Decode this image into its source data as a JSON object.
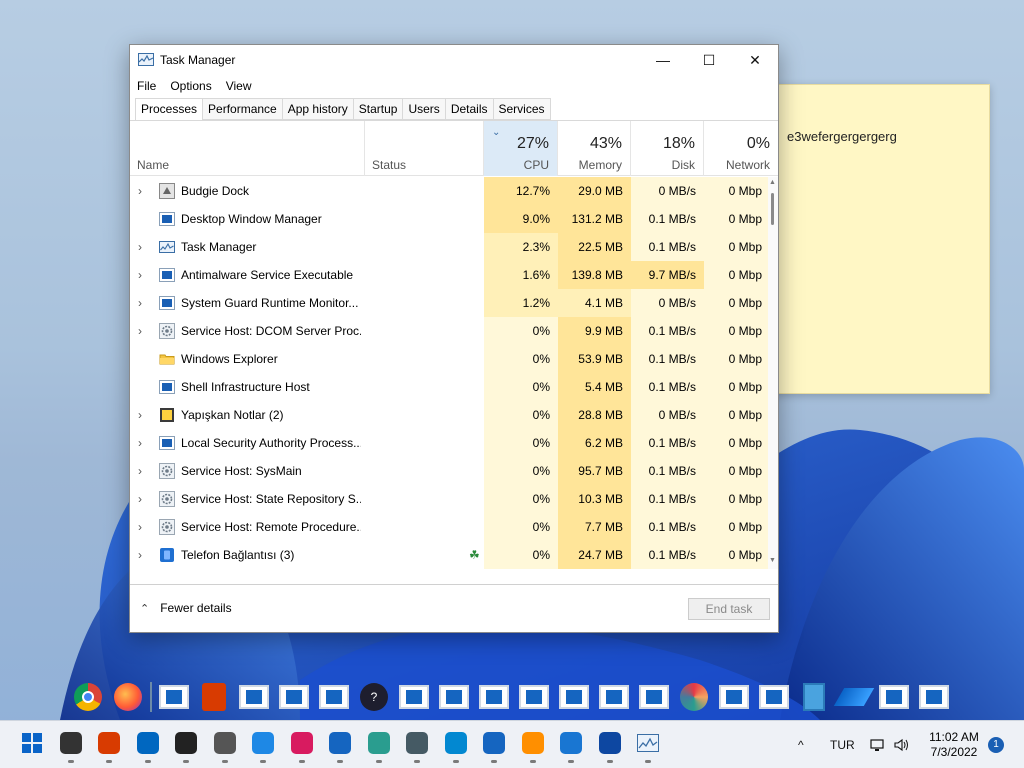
{
  "sticky_note": {
    "text": "e3wefergergergerg"
  },
  "window": {
    "title": "Task Manager",
    "controls": {
      "minimize": "—",
      "maximize": "☐",
      "close": "✕"
    }
  },
  "menu": [
    "File",
    "Options",
    "View"
  ],
  "tabs": [
    "Processes",
    "Performance",
    "App history",
    "Startup",
    "Users",
    "Details",
    "Services"
  ],
  "active_tab": "Processes",
  "columns": {
    "name": "Name",
    "status": "Status",
    "cpu": {
      "label": "CPU",
      "percent": "27%"
    },
    "memory": {
      "label": "Memory",
      "percent": "43%"
    },
    "disk": {
      "label": "Disk",
      "percent": "18%"
    },
    "network": {
      "label": "Network",
      "percent": "0%"
    }
  },
  "processes": [
    {
      "expand": "›",
      "icon": "budgie-dock-icon",
      "name": "Budgie Dock",
      "status": "",
      "cpu": "12.7%",
      "memory": "29.0 MB",
      "disk": "0 MB/s",
      "network": "0 Mbp"
    },
    {
      "expand": "",
      "icon": "window-icon",
      "name": "Desktop Window Manager",
      "status": "",
      "cpu": "9.0%",
      "memory": "131.2 MB",
      "disk": "0.1 MB/s",
      "network": "0 Mbp"
    },
    {
      "expand": "›",
      "icon": "task-manager-icon",
      "name": "Task Manager",
      "status": "",
      "cpu": "2.3%",
      "memory": "22.5 MB",
      "disk": "0.1 MB/s",
      "network": "0 Mbp"
    },
    {
      "expand": "›",
      "icon": "window-icon",
      "name": "Antimalware Service Executable",
      "status": "",
      "cpu": "1.6%",
      "memory": "139.8 MB",
      "disk": "9.7 MB/s",
      "network": "0 Mbp"
    },
    {
      "expand": "›",
      "icon": "window-icon",
      "name": "System Guard Runtime Monitor...",
      "status": "",
      "cpu": "1.2%",
      "memory": "4.1 MB",
      "disk": "0 MB/s",
      "network": "0 Mbp"
    },
    {
      "expand": "›",
      "icon": "gear-icon",
      "name": "Service Host: DCOM Server Proc...",
      "status": "",
      "cpu": "0%",
      "memory": "9.9 MB",
      "disk": "0.1 MB/s",
      "network": "0 Mbp"
    },
    {
      "expand": "",
      "icon": "folder-icon",
      "name": "Windows Explorer",
      "status": "",
      "cpu": "0%",
      "memory": "53.9 MB",
      "disk": "0.1 MB/s",
      "network": "0 Mbp"
    },
    {
      "expand": "",
      "icon": "window-icon",
      "name": "Shell Infrastructure Host",
      "status": "",
      "cpu": "0%",
      "memory": "5.4 MB",
      "disk": "0.1 MB/s",
      "network": "0 Mbp"
    },
    {
      "expand": "›",
      "icon": "sticky-notes-icon",
      "name": "Yapışkan Notlar (2)",
      "status": "",
      "cpu": "0%",
      "memory": "28.8 MB",
      "disk": "0 MB/s",
      "network": "0 Mbp"
    },
    {
      "expand": "›",
      "icon": "window-icon",
      "name": "Local Security Authority Process...",
      "status": "",
      "cpu": "0%",
      "memory": "6.2 MB",
      "disk": "0.1 MB/s",
      "network": "0 Mbp"
    },
    {
      "expand": "›",
      "icon": "gear-icon",
      "name": "Service Host: SysMain",
      "status": "",
      "cpu": "0%",
      "memory": "95.7 MB",
      "disk": "0.1 MB/s",
      "network": "0 Mbp"
    },
    {
      "expand": "›",
      "icon": "gear-icon",
      "name": "Service Host: State Repository S...",
      "status": "",
      "cpu": "0%",
      "memory": "10.3 MB",
      "disk": "0.1 MB/s",
      "network": "0 Mbp"
    },
    {
      "expand": "›",
      "icon": "gear-icon",
      "name": "Service Host: Remote Procedure...",
      "status": "",
      "cpu": "0%",
      "memory": "7.7 MB",
      "disk": "0.1 MB/s",
      "network": "0 Mbp"
    },
    {
      "expand": "›",
      "icon": "phone-link-icon",
      "name": "Telefon Bağlantısı (3)",
      "status": "",
      "cpu": "0%",
      "memory": "24.7 MB",
      "disk": "0.1 MB/s",
      "network": "0 Mbp",
      "suspended": true
    }
  ],
  "footer": {
    "fewer_details": "Fewer details",
    "end_task": "End task"
  },
  "dock_icons": [
    "chrome-icon",
    "firefox-icon",
    "window-icon",
    "office-icon",
    "window-icon",
    "window-icon",
    "window-icon",
    "help-icon",
    "window-icon",
    "window-icon",
    "window-icon",
    "window-icon",
    "window-icon",
    "window-icon",
    "window-icon",
    "paint-icon",
    "window-icon",
    "window-icon",
    "notepad-icon",
    "azure-icon",
    "window-icon",
    "window-icon"
  ],
  "taskbar_icons": [
    "start-icon",
    "solitaire-icon",
    "office-icon",
    "remote-desktop-icon",
    "media-player-icon",
    "camera-icon",
    "tips-icon",
    "snipping-tool-icon",
    "notepad-icon",
    "paint-icon",
    "calculator-icon",
    "photos-icon",
    "store-icon",
    "edge-canary-icon",
    "todo-icon",
    "power-automate-icon",
    "task-manager-icon"
  ],
  "tray": {
    "chevron": "^",
    "language": "TUR",
    "time": "11:02 AM",
    "date": "7/3/2022",
    "notifications": "1"
  },
  "colors": {
    "heat_high": "#ffe599",
    "heat_mid": "#fff0b8",
    "heat_low": "#fff8d9",
    "accent": "#1a5fb4"
  }
}
